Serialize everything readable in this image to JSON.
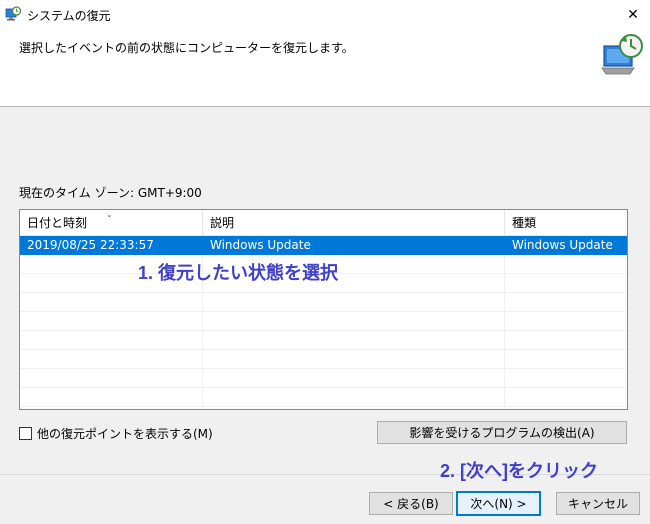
{
  "window": {
    "title": "システムの復元",
    "close_glyph": "✕"
  },
  "header": {
    "instruction": "選択したイベントの前の状態にコンピューターを復元します。"
  },
  "timezone_label": "現在のタイム ゾーン: GMT+9:00",
  "restore_points": {
    "columns": [
      "日付と時刻",
      "説明",
      "種類"
    ],
    "sort_glyph": "⌄",
    "rows": [
      {
        "datetime": "2019/08/25 22:33:57",
        "description": "Windows Update",
        "type": "Windows Update",
        "selected": true
      }
    ]
  },
  "annotations": {
    "step1": "1. 復元したい状態を選択",
    "step2": "2. [次へ]をクリック"
  },
  "show_more_checkbox": {
    "label": "他の復元ポイントを表示する(M)",
    "checked": false
  },
  "buttons": {
    "scan": "影響を受けるプログラムの検出(A)",
    "back": "< 戻る(B)",
    "next": "次へ(N) >",
    "cancel": "キャンセル"
  },
  "colors": {
    "selection": "#0078d7",
    "annotation": "#4040c8"
  }
}
